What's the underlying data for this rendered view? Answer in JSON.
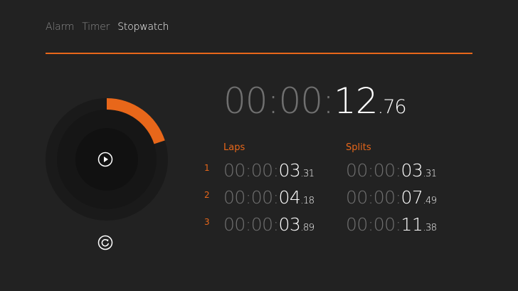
{
  "tabs": [
    {
      "label": "Alarm",
      "active": false
    },
    {
      "label": "Timer",
      "active": false
    },
    {
      "label": "Stopwatch",
      "active": true
    }
  ],
  "stopwatch": {
    "elapsed": {
      "hours": "00",
      "minutes": "00",
      "seconds": "12",
      "hundredths": "76"
    },
    "progress_fraction": 0.2,
    "controls": {
      "play_icon": "play-icon",
      "reset_icon": "reset-icon"
    }
  },
  "columns": {
    "laps_label": "Laps",
    "splits_label": "Splits"
  },
  "laps": [
    {
      "number": "1",
      "lap": {
        "h": "00",
        "m": "00",
        "s": "03",
        "cs": "31"
      },
      "split": {
        "h": "00",
        "m": "00",
        "s": "03",
        "cs": "31"
      }
    },
    {
      "number": "2",
      "lap": {
        "h": "00",
        "m": "00",
        "s": "04",
        "cs": "18"
      },
      "split": {
        "h": "00",
        "m": "00",
        "s": "07",
        "cs": "49"
      }
    },
    {
      "number": "3",
      "lap": {
        "h": "00",
        "m": "00",
        "s": "03",
        "cs": "89"
      },
      "split": {
        "h": "00",
        "m": "00",
        "s": "11",
        "cs": "38"
      }
    }
  ],
  "colors": {
    "accent": "#e8671a",
    "background": "#222222",
    "dim_text": "#707070"
  }
}
